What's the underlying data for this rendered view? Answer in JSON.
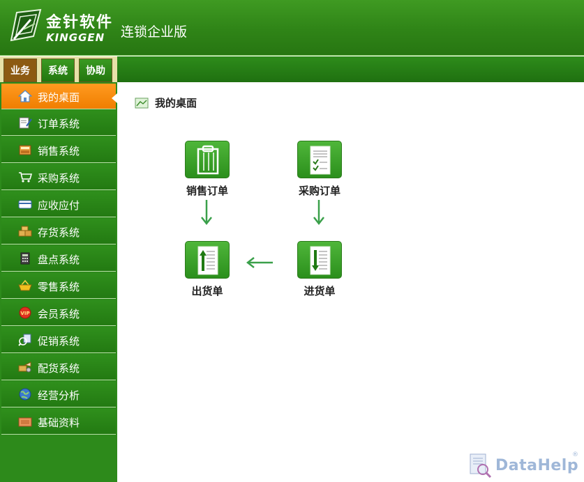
{
  "header": {
    "brand_cn": "金针软件",
    "brand_en": "KINGGEN",
    "edition": "连锁企业版",
    "logo_icon": "kinggen-logo-icon"
  },
  "tabs": [
    {
      "label": "业务",
      "active": true
    },
    {
      "label": "系统",
      "active": false
    },
    {
      "label": "协助",
      "active": false
    }
  ],
  "sidebar": {
    "items": [
      {
        "label": "我的桌面",
        "icon": "home-icon",
        "active": true
      },
      {
        "label": "订单系统",
        "icon": "order-icon",
        "active": false
      },
      {
        "label": "销售系统",
        "icon": "cash-register-icon",
        "active": false
      },
      {
        "label": "采购系统",
        "icon": "shopping-cart-icon",
        "active": false
      },
      {
        "label": "应收应付",
        "icon": "card-icon",
        "active": false
      },
      {
        "label": "存货系统",
        "icon": "boxes-icon",
        "active": false
      },
      {
        "label": "盘点系统",
        "icon": "calculator-icon",
        "active": false
      },
      {
        "label": "零售系统",
        "icon": "basket-icon",
        "active": false
      },
      {
        "label": "会员系统",
        "icon": "vip-icon",
        "active": false
      },
      {
        "label": "促销系统",
        "icon": "promotion-icon",
        "active": false
      },
      {
        "label": "配货系统",
        "icon": "delivery-icon",
        "active": false
      },
      {
        "label": "经营分析",
        "icon": "globe-icon",
        "active": false
      },
      {
        "label": "基础资料",
        "icon": "folder-icon",
        "active": false
      }
    ]
  },
  "main": {
    "title": "我的桌面",
    "title_icon": "desktop-icon",
    "flow": {
      "sales_order": {
        "label": "销售订单",
        "icon": "clipboard-icon"
      },
      "purchase_order": {
        "label": "采购订单",
        "icon": "checklist-icon"
      },
      "outbound": {
        "label": "出货单",
        "icon": "document-up-icon"
      },
      "inbound": {
        "label": "进货单",
        "icon": "document-down-icon"
      }
    }
  },
  "watermark": {
    "text": "DataHelp",
    "registered": "®"
  },
  "colors": {
    "header_green": "#2f8417",
    "sidebar_green": "#2d8a1b",
    "active_orange": "#f07e00",
    "tab_active_brown": "#8c5a12",
    "flow_arrow_green": "#3aa04a"
  }
}
